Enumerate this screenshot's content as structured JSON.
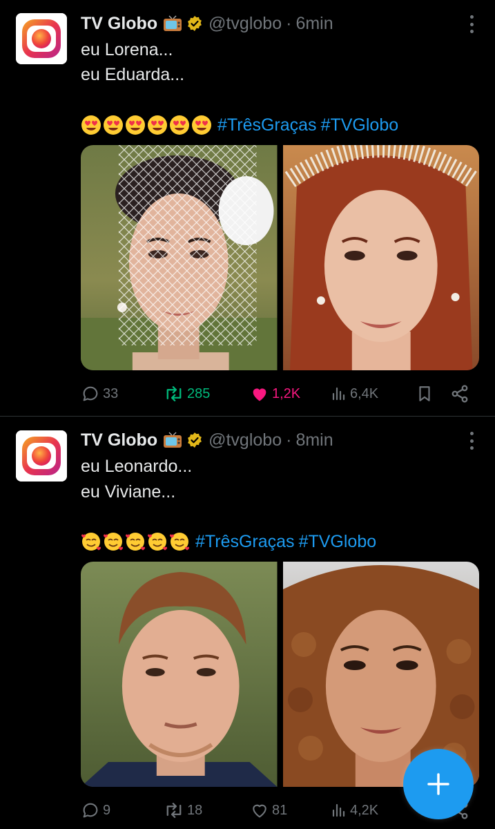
{
  "colors": {
    "background": "#000000",
    "text": "#e7e9ea",
    "muted": "#71767b",
    "link": "#1d9bf0",
    "retweet": "#00ba7c",
    "like": "#f91880"
  },
  "tweets": [
    {
      "author": {
        "name": "TV Globo",
        "handle": "@tvglobo",
        "verified": true,
        "badge_icon": "television-emoji"
      },
      "separator": "·",
      "time": "6min",
      "lines": [
        "eu Lorena...",
        "eu Eduarda..."
      ],
      "emojis": [
        "smiling-face-with-heart-eyes",
        "smiling-face-with-heart-eyes",
        "smiling-face-with-heart-eyes",
        "smiling-face-with-heart-eyes",
        "smiling-face-with-heart-eyes",
        "smiling-face-with-heart-eyes"
      ],
      "hashtags": [
        "#TrêsGraças",
        "#TVGlobo"
      ],
      "media": [
        {
          "desc": "woman-with-veil"
        },
        {
          "desc": "woman-red-hair-pearl-headband"
        }
      ],
      "stats": {
        "replies": "33",
        "retweets": "285",
        "likes": "1,2K",
        "views": "6,4K"
      },
      "retweeted": true,
      "liked": true
    },
    {
      "author": {
        "name": "TV Globo",
        "handle": "@tvglobo",
        "verified": true,
        "badge_icon": "television-emoji"
      },
      "separator": "·",
      "time": "8min",
      "lines": [
        "eu Leonardo...",
        "eu Viviane..."
      ],
      "emojis": [
        "smiling-face-with-hearts",
        "smiling-face-with-hearts",
        "smiling-face-with-hearts",
        "smiling-face-with-hearts",
        "smiling-face-with-hearts"
      ],
      "hashtags": [
        "#TrêsGraças",
        "#TVGlobo"
      ],
      "media": [
        {
          "desc": "man-red-hair"
        },
        {
          "desc": "woman-curly-hair"
        }
      ],
      "stats": {
        "replies": "9",
        "retweets": "18",
        "likes": "81",
        "views": "4,2K"
      },
      "retweeted": false,
      "liked": false
    }
  ],
  "fab": {
    "icon": "plus-icon"
  }
}
